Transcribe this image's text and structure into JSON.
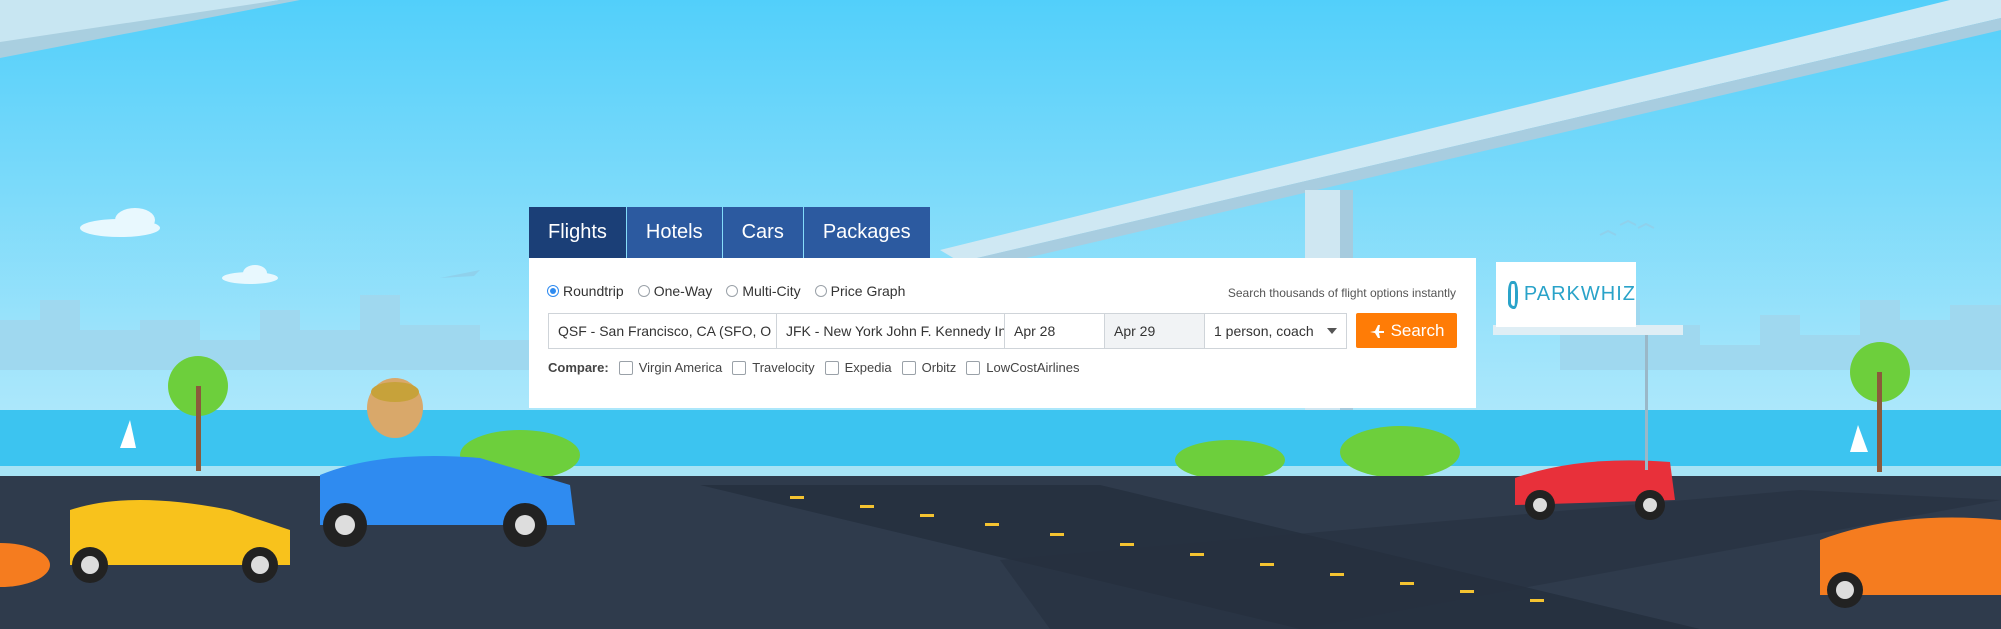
{
  "tabs": [
    {
      "label": "Flights",
      "active": true
    },
    {
      "label": "Hotels",
      "active": false
    },
    {
      "label": "Cars",
      "active": false
    },
    {
      "label": "Packages",
      "active": false
    }
  ],
  "trip_types": [
    {
      "label": "Roundtrip",
      "selected": true
    },
    {
      "label": "One-Way",
      "selected": false
    },
    {
      "label": "Multi-City",
      "selected": false
    },
    {
      "label": "Price Graph",
      "selected": false
    }
  ],
  "tagline": "Search thousands of flight options instantly",
  "fields": {
    "origin": "QSF - San Francisco, CA (SFO, O",
    "destination": "JFK - New York John F. Kennedy In",
    "depart": "Apr 28",
    "return": "Apr 29",
    "travelers": "1 person, coach"
  },
  "search_label": "Search",
  "compare": {
    "label": "Compare:",
    "options": [
      "Virgin America",
      "Travelocity",
      "Expedia",
      "Orbitz",
      "LowCostAirlines"
    ]
  },
  "billboard": {
    "brand_text": "PARKWHIZ"
  },
  "colors": {
    "tab": "#2c5aa0",
    "tab_active": "#1b3f77",
    "search_button": "#ff7c06",
    "sky": "#4fd1f7",
    "road": "#2f3b4c"
  },
  "icons": [
    "plane-icon",
    "parkwhiz-logo-icon",
    "chevron-down-icon"
  ]
}
